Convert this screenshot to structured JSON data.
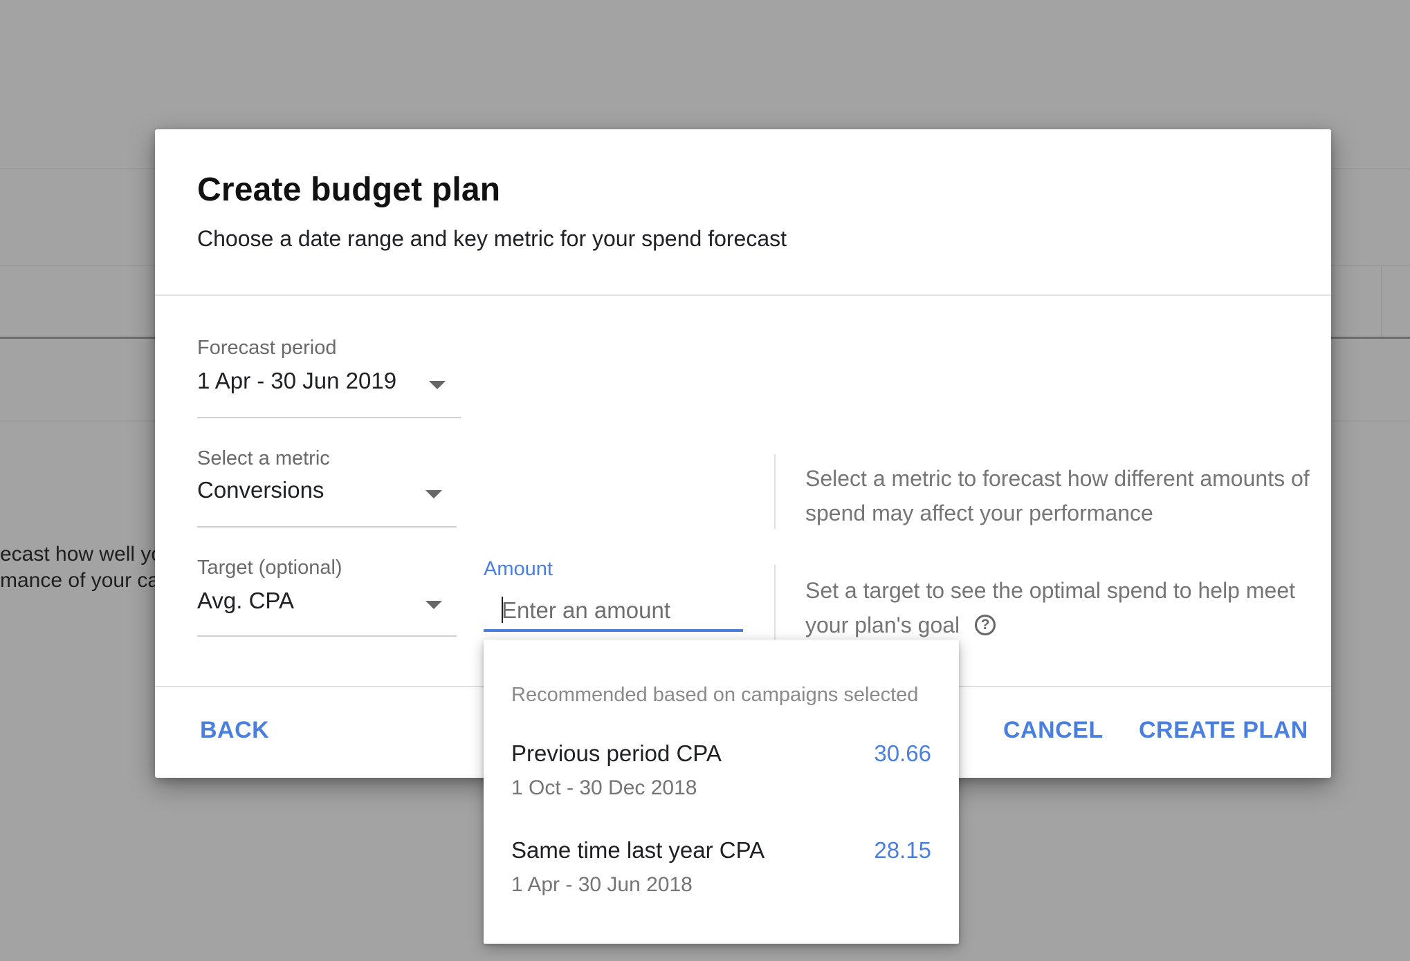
{
  "background": {
    "text_line_1": "ecast how well yo",
    "text_line_2": "mance of your ca"
  },
  "dialog": {
    "title": "Create budget plan",
    "subtitle": "Choose a date range and key metric for your spend forecast",
    "forecast_period": {
      "label": "Forecast period",
      "value": "1 Apr - 30 Jun 2019"
    },
    "metric": {
      "label": "Select a metric",
      "value": "Conversions"
    },
    "target": {
      "label": "Target (optional)",
      "value": "Avg. CPA"
    },
    "amount": {
      "label": "Amount",
      "placeholder": "Enter an amount",
      "value": ""
    },
    "metric_help": "Select a metric to forecast how different amounts of spend may affect your performance",
    "target_help": "Set a target to see the optimal spend to help meet your plan's goal",
    "help_icon_glyph": "?",
    "buttons": {
      "back": "BACK",
      "cancel": "CANCEL",
      "create": "CREATE PLAN"
    }
  },
  "recommendations": {
    "header": "Recommended based on campaigns selected",
    "items": [
      {
        "title": "Previous period CPA",
        "value": "30.66",
        "period": "1 Oct - 30 Dec 2018"
      },
      {
        "title": "Same time last year CPA",
        "value": "28.15",
        "period": "1 Apr - 30 Jun 2018"
      }
    ]
  },
  "colors": {
    "accent": "#4a7fe0",
    "overlay": "#a3a3a3"
  }
}
